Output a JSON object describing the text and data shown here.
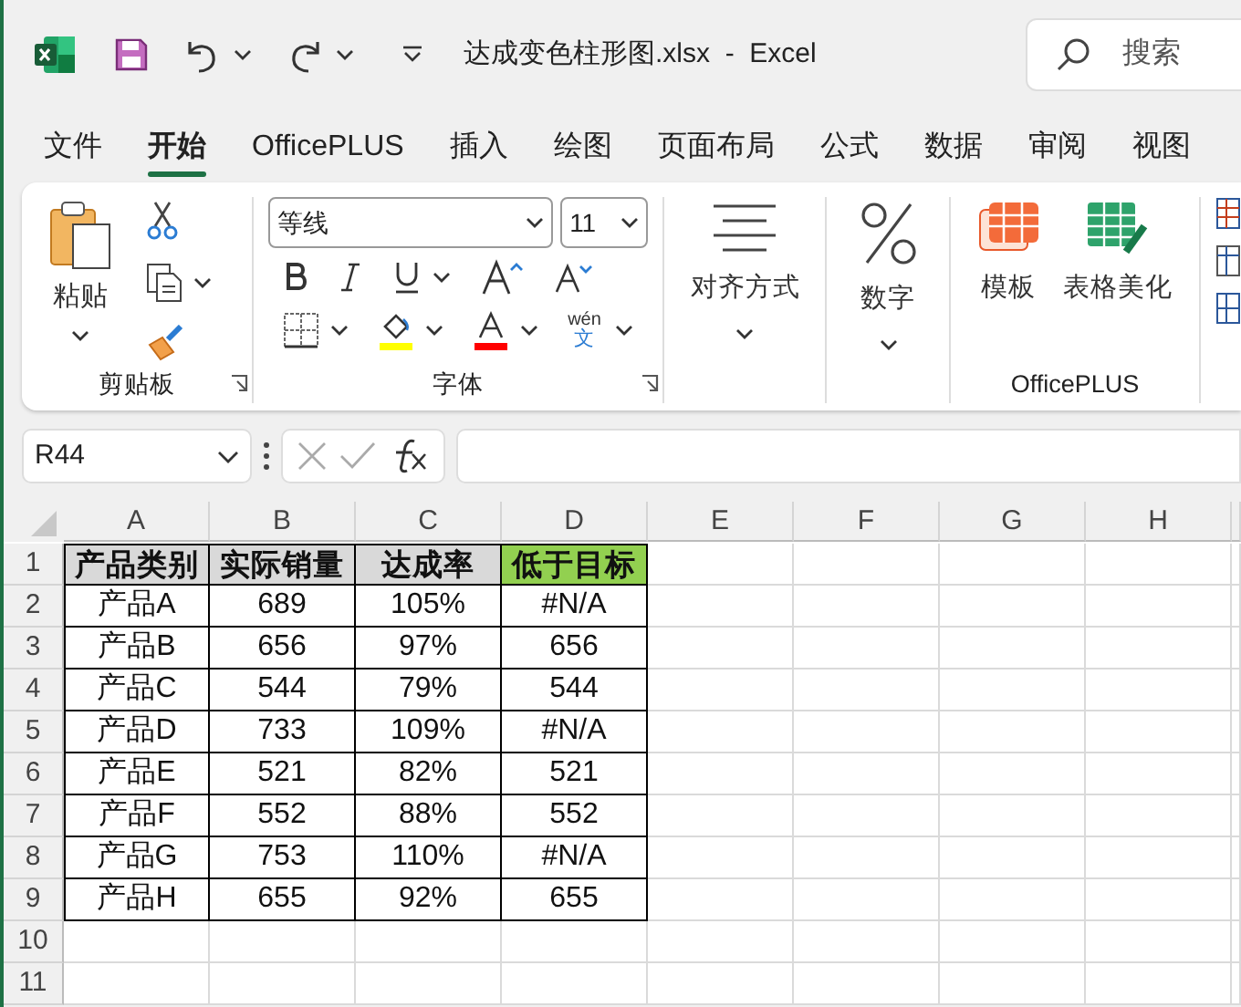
{
  "title_bar": {
    "document_title": "达成变色柱形图.xlsx  -  Excel",
    "search_placeholder": "搜索"
  },
  "menu_tabs": [
    {
      "label": "文件",
      "selected": false
    },
    {
      "label": "开始",
      "selected": true
    },
    {
      "label": "OfficePLUS",
      "selected": false
    },
    {
      "label": "插入",
      "selected": false
    },
    {
      "label": "绘图",
      "selected": false
    },
    {
      "label": "页面布局",
      "selected": false
    },
    {
      "label": "公式",
      "selected": false
    },
    {
      "label": "数据",
      "selected": false
    },
    {
      "label": "审阅",
      "selected": false
    },
    {
      "label": "视图",
      "selected": false
    }
  ],
  "ribbon": {
    "clipboard": {
      "paste_label": "粘贴",
      "group_label": "剪贴板"
    },
    "font": {
      "font_name": "等线",
      "font_size": "11",
      "phonetic_top": "wén",
      "phonetic_bottom": "文",
      "group_label": "字体"
    },
    "alignment": {
      "label": "对齐方式"
    },
    "number": {
      "label": "数字"
    },
    "officeplus": {
      "buttons": [
        "模板",
        "表格美化"
      ],
      "group_label": "OfficePLUS"
    }
  },
  "formula_bar": {
    "name_box": "R44"
  },
  "sheet": {
    "columns": [
      "A",
      "B",
      "C",
      "D",
      "E",
      "F",
      "G",
      "H"
    ],
    "header_row": {
      "number": "1",
      "cells": [
        {
          "text": "产品类别",
          "color": "#d9d9d9"
        },
        {
          "text": "实际销量",
          "color": "#d9d9d9"
        },
        {
          "text": "达成率",
          "color": "#d9d9d9"
        },
        {
          "text": "低于目标",
          "color": "#92d050"
        }
      ]
    },
    "data_rows": [
      {
        "number": "2",
        "cells": [
          "产品A",
          "689",
          "105%",
          "#N/A"
        ]
      },
      {
        "number": "3",
        "cells": [
          "产品B",
          "656",
          "97%",
          "656"
        ]
      },
      {
        "number": "4",
        "cells": [
          "产品C",
          "544",
          "79%",
          "544"
        ]
      },
      {
        "number": "5",
        "cells": [
          "产品D",
          "733",
          "109%",
          "#N/A"
        ]
      },
      {
        "number": "6",
        "cells": [
          "产品E",
          "521",
          "82%",
          "521"
        ]
      },
      {
        "number": "7",
        "cells": [
          "产品F",
          "552",
          "88%",
          "552"
        ]
      },
      {
        "number": "8",
        "cells": [
          "产品G",
          "753",
          "110%",
          "#N/A"
        ]
      },
      {
        "number": "9",
        "cells": [
          "产品H",
          "655",
          "92%",
          "655"
        ]
      }
    ],
    "empty_rows": [
      {
        "number": "10"
      },
      {
        "number": "11"
      }
    ]
  }
}
